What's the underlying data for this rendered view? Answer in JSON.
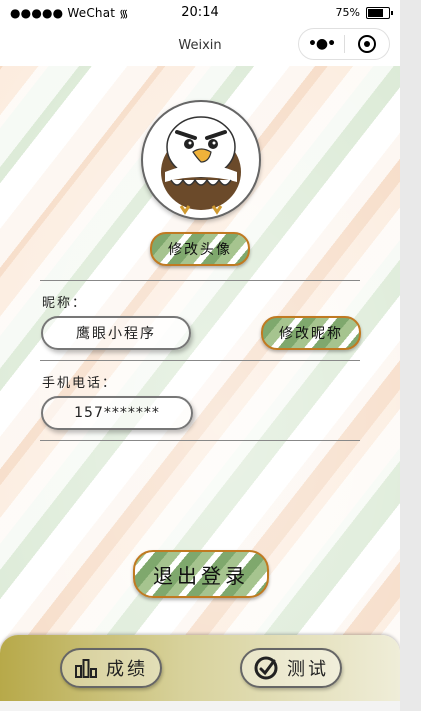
{
  "status_bar": {
    "signal": "●●●●● WeChat",
    "wifi_icon": "wifi-icon",
    "time": "20:14",
    "battery_percent": "75%",
    "battery_level": 0.75
  },
  "nav": {
    "title": "Weixin",
    "more_icon": "more-dots-icon",
    "close_icon": "record-icon"
  },
  "profile": {
    "change_avatar_label": "修改头像",
    "nickname_label": "昵称：",
    "nickname_value": "鹰眼小程序",
    "change_nickname_label": "修改昵称",
    "phone_label": "手机电话：",
    "phone_value": "157*******"
  },
  "logout_label": "退出登录",
  "tabbar": {
    "items": [
      {
        "label": "成绩",
        "icon": "bar-chart-icon"
      },
      {
        "label": "测试",
        "icon": "gauge-icon"
      }
    ]
  },
  "colors": {
    "button_border": "#c07a22",
    "button_green": "#7fa86d",
    "tabbar_olive": "#b7a949"
  }
}
